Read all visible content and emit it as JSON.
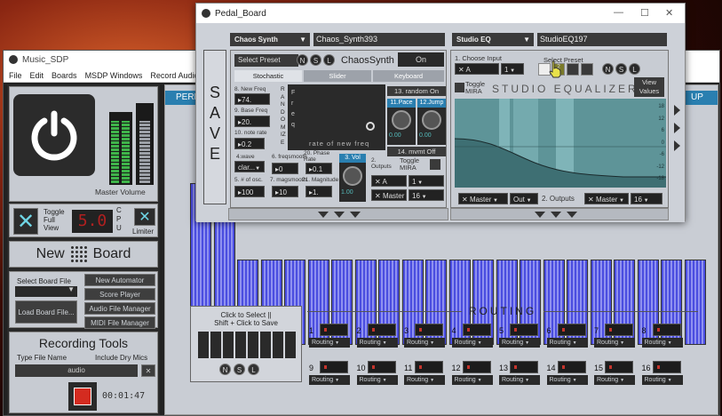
{
  "bg_window": {
    "title": "Music_SDP",
    "menu": [
      "File",
      "Edit",
      "Boards",
      "MSDP Windows",
      "Record Audio",
      "Au"
    ],
    "left_panel": {
      "master_volume_label": "Master Volume",
      "toggle_full_view_label": "Toggle Full View",
      "cpu_value": "5.0",
      "cpu_label": "C P U",
      "limiter_label": "Limiter",
      "new_board_label": "New",
      "board_label": "Board",
      "select_board_file": "Select Board File",
      "new_automator": "New Automator",
      "score_player": "Score Player",
      "load_board_file": "Load Board File...",
      "audio_file_manager": "Audio File Manager",
      "midi_file_manager": "MIDI File Manager",
      "recording_tools": "Recording Tools",
      "type_file_name": "Type File Name",
      "include_dry_mics": "Include Dry Mics",
      "file_name_value": "audio",
      "timer": "00:01:47"
    },
    "main": {
      "perf_tab": "PERF",
      "up_tab": "UP",
      "routing_title": "ROUTING",
      "click_select": "Click to Select ||",
      "shift_click": "Shift + Click to Save",
      "nsl": [
        "N",
        "S",
        "L"
      ],
      "routing_channels": [
        "1",
        "2",
        "3",
        "4",
        "5",
        "6",
        "7",
        "8",
        "9",
        "10",
        "11",
        "12",
        "13",
        "14",
        "15",
        "16"
      ],
      "routing_label": "Routing"
    }
  },
  "pedal_board": {
    "title": "Pedal_Board",
    "save_label": "S A V E",
    "chaos": {
      "type": "Chaos Synth",
      "name": "Chaos_Synth393",
      "select_preset": "Select Preset",
      "nsl": [
        "N",
        "S",
        "L"
      ],
      "title": "ChaosSynth",
      "on_label": "On",
      "tabs": [
        "Stochastic",
        "Slider",
        "Keyboard"
      ],
      "new_freq_label": "8. New Freq",
      "new_freq_value": "74.",
      "base_freq_label": "9. Base Freq",
      "base_freq_value": "20.",
      "note_rate_label": "10. note rate",
      "note_rate_value": "0.2",
      "wave_label": "4.wave",
      "wave_value": "clar...",
      "osc_label": "5. # of osc.",
      "osc_value": "100",
      "freqsmooth_label": "6. freqsmooth",
      "freqsmooth_value": "0",
      "magsmooth_label": "7. magsmooth",
      "magsmooth_value": "10",
      "phase_rate_label": "20. Phase Rate",
      "phase_rate_value": "0.1",
      "magnitude_label": "21. Magnitude",
      "magnitude_value": "1.",
      "randomize_vertical": "RANDOMIZE",
      "freq_vertical": "Freq",
      "rate_label": "rate of new freq",
      "random_on": "13. random On",
      "pace_label": "11.Pace",
      "jump_label": "12.Jump",
      "knob_value": "0.00",
      "mvmt_off": "14. mvmt Off",
      "vol_label": "3. Vol",
      "vol_value": "1.00",
      "outputs_label": "2. Outputs",
      "toggle_mira": "Toggle MIRA",
      "out_a": "A",
      "out_1": "1",
      "master": "Master",
      "master_num": "16"
    },
    "eq": {
      "type": "Studio EQ",
      "name": "StudioEQ197",
      "choose_input": "1. Choose Input",
      "input_a": "A",
      "input_1": "1",
      "select_preset": "Select Preset",
      "preset_num": "2",
      "nsl": [
        "N",
        "S",
        "L"
      ],
      "toggle_mira": "Toggle MIRA",
      "title": "STUDIO EQUALIZER",
      "view_values": "View Values",
      "y_ticks": [
        "18",
        "12",
        "6",
        "0",
        "-6",
        "-12",
        "-18"
      ],
      "master": "Master",
      "out": "Out",
      "outputs_label": "2. Outputs",
      "master2": "Master",
      "master_num": "16"
    }
  }
}
